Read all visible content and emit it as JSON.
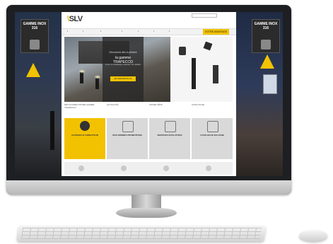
{
  "site": {
    "logo": "SLV",
    "nav_cta": "VOTRE AVANTAGE"
  },
  "banners": {
    "left_title": "GAMME INOX 316",
    "right_title": "GAMME INOX 316"
  },
  "hero": {
    "line1": "Découvrez dès à présent",
    "line2": "la gamme TRAPECCO",
    "line3": "Pour un éclairage extérieur de qualité",
    "button": "EN SAVOIR PLUS"
  },
  "subrow": [
    "DÉCOUVREZ NOTRE GAMME TRAPECCO",
    "ACTUALITÉ",
    "OFFRE FÊTE",
    "CATALOGUE"
  ],
  "features": [
    {
      "title": "ACCÉDEZ AU DIRECTEUR",
      "desc": ""
    },
    {
      "title": "NOS BONNES PROMOTIONS",
      "desc": ""
    },
    {
      "title": "SERVICES ÉVOLUTIVES",
      "desc": ""
    },
    {
      "title": "CATALOGUE EN LIGNE",
      "desc": ""
    }
  ]
}
